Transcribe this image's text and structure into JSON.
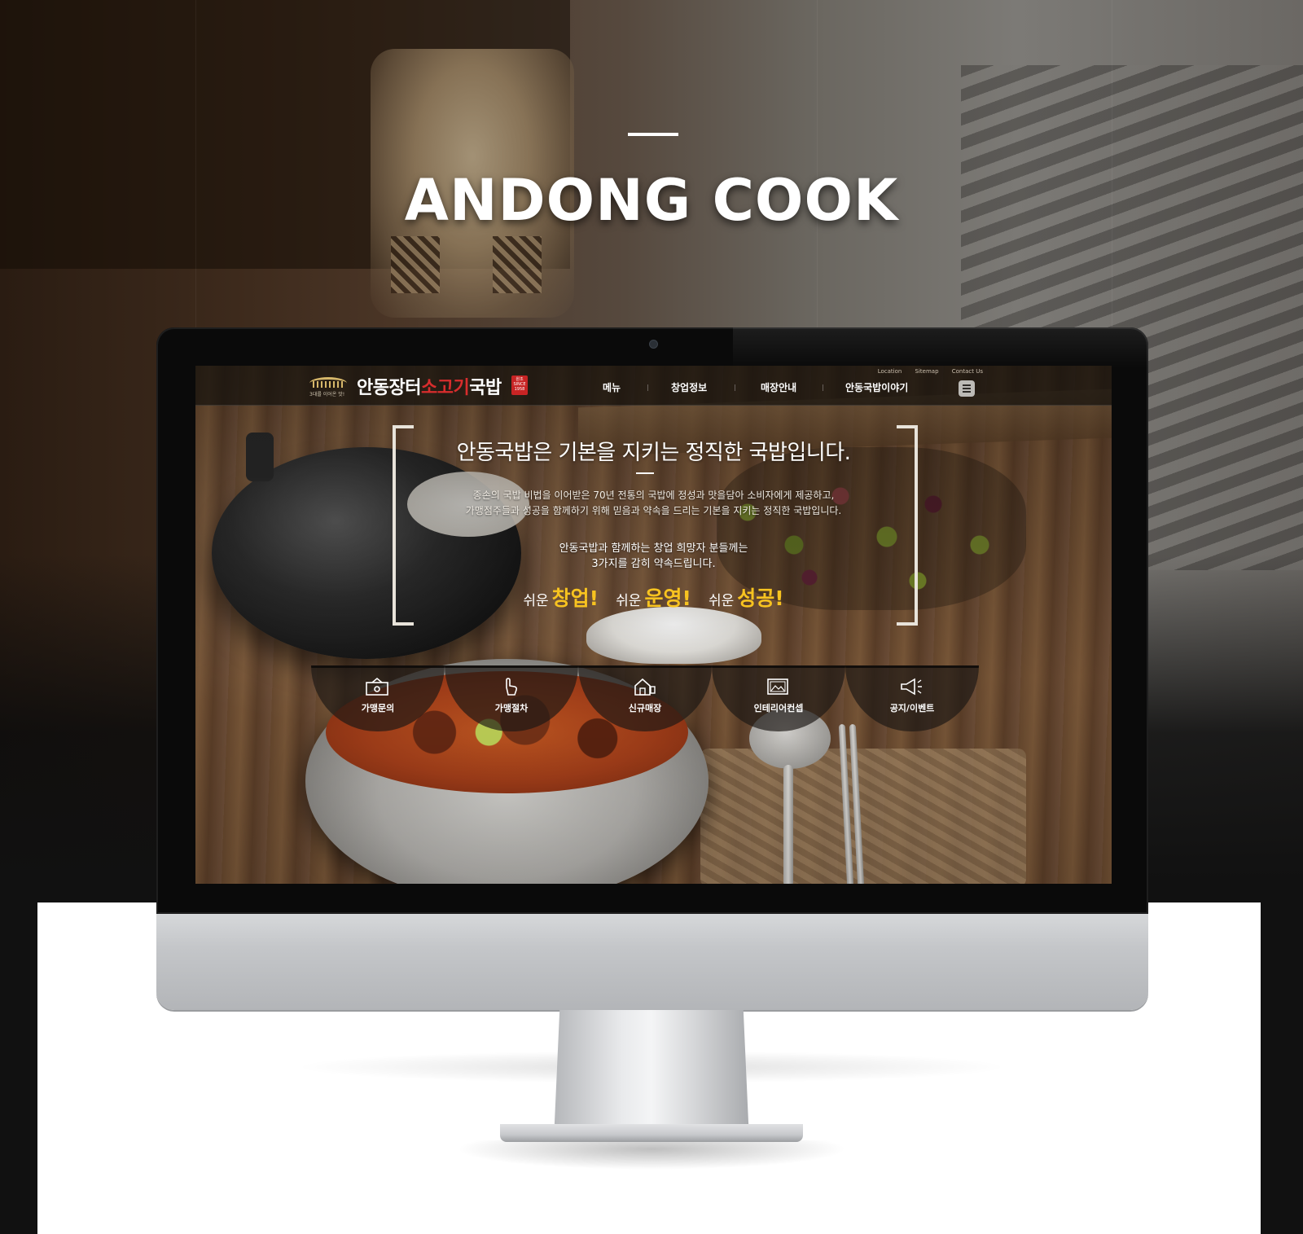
{
  "showcase": {
    "title": "ANDONG COOK"
  },
  "site": {
    "logo": {
      "tagline": "3대를 이어온 맛!",
      "name_white_1": "안동장터",
      "name_red": "소고기",
      "name_white_2": "국밥",
      "seal": "원조 SINCE 1958"
    },
    "utility_links": [
      "Location",
      "Sitemap",
      "Contact Us"
    ],
    "nav": [
      "메뉴",
      "창업정보",
      "매장안내",
      "안동국밥이야기"
    ],
    "menu_icon": "hamburger-menu-icon",
    "hero": {
      "title": "안동국밥은 기본을 지키는 정직한 국밥입니다.",
      "desc_line1": "종손의 국밥 비법을 이어받은 70년 전통의 국밥에 정성과 맛을담아 소비자에게 제공하고,",
      "desc_line2": "가맹점주들과 성공을 함께하기 위해 믿음과 약속을 드리는 기본을 지키는 정직한 국밥입니다.",
      "sub_line1": "안동국밥과 함께하는 창업 희망자 분들께는",
      "sub_line2": "3가지를 감히 약속드립니다.",
      "slogans": [
        {
          "prefix": "쉬운",
          "word": "창업!"
        },
        {
          "prefix": "쉬운",
          "word": "운영!"
        },
        {
          "prefix": "쉬운",
          "word": "성공!"
        }
      ],
      "slogan_color": "#f7c320"
    },
    "quick_menu": [
      {
        "label": "가맹문의",
        "icon": "camera-box-icon"
      },
      {
        "label": "가맹절차",
        "icon": "hand-pointer-icon"
      },
      {
        "label": "신규매장",
        "icon": "store-house-icon"
      },
      {
        "label": "인테리어컨셉",
        "icon": "picture-frame-icon"
      },
      {
        "label": "공지/이벤트",
        "icon": "megaphone-icon"
      }
    ],
    "brand_red": "#d82d2d"
  }
}
